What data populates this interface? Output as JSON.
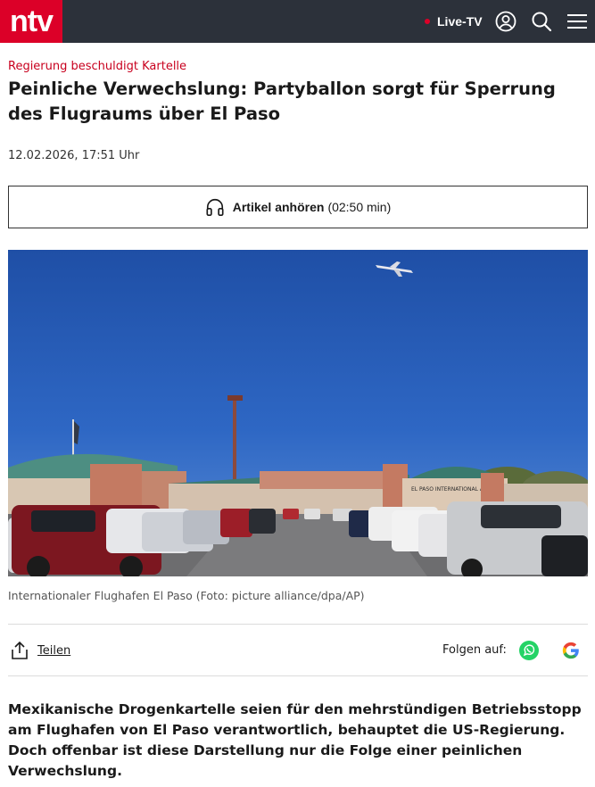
{
  "header": {
    "logo_text": "ntv",
    "live_label": "Live-TV",
    "icons": [
      "user-icon",
      "search-icon",
      "menu-icon"
    ],
    "brand_color": "#dc0028",
    "bar_color": "#2c313a"
  },
  "article": {
    "kicker": "Regierung beschuldigt Kartelle",
    "headline": "Peinliche Verwechslung: Partyballon sorgt für Sperrung des Flugraums über El Paso",
    "date": "12.02.2026, 17:51 Uhr",
    "audio": {
      "label": "Artikel anhören",
      "duration": "(02:50 min)",
      "icon": "headphones-icon"
    },
    "photo": {
      "caption": "Internationaler Flughafen El Paso (Foto: picture alliance/dpa/AP)",
      "building_sign": "EL PASO INTERNATIONAL AIRPORT"
    },
    "share_label": "Teilen",
    "follow_label": "Folgen auf:",
    "follow_icons": [
      "whatsapp-icon",
      "google-icon"
    ],
    "lead": "Mexikanische Drogenkartelle seien für den mehrstündigen Betriebsstopp am Flughafen von El Paso verantwortlich, behauptet die US-Regierung. Doch offenbar ist diese Darstellung nur die Folge einer peinlichen Verwechslung."
  }
}
